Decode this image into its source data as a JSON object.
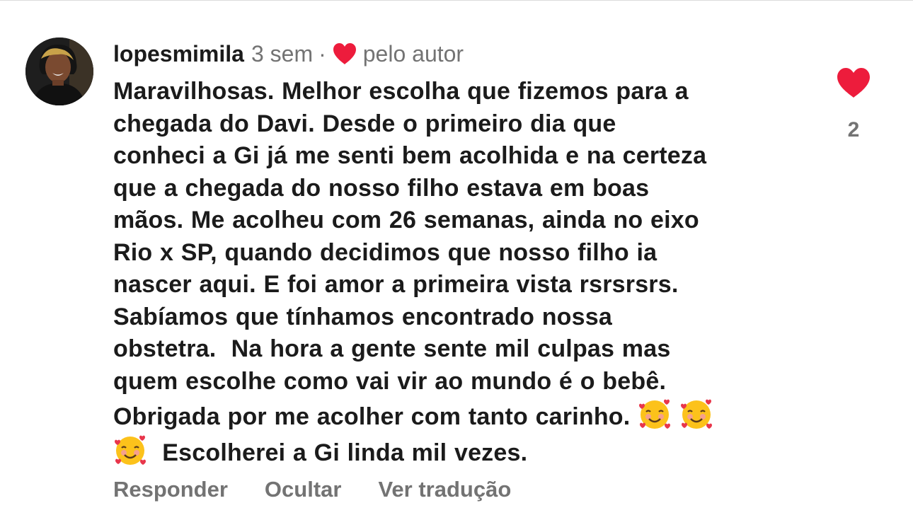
{
  "comment": {
    "username": "lopesmimila",
    "time": "3 sem",
    "separator": "·",
    "liked_by_author_label": "pelo autor",
    "body_lines": [
      "Maravilhosas. Melhor escolha que fizemos para a",
      "chegada do Davi. Desde o primeiro dia que",
      "conheci a Gi já me senti bem acolhida e na certeza",
      "que a chegada do nosso filho estava em boas",
      "mãos. Me acolheu com 26 semanas, ainda no eixo",
      "Rio x SP, quando decidimos que nosso filho ia",
      "nascer aqui. E foi amor a primeira vista rsrsrsrs.",
      "Sabíamos que tínhamos encontrado nossa",
      "obstetra.  Na hora a gente sente mil culpas mas",
      "quem escolhe como vai vir ao mundo é o bebê.",
      "Obrigada por me acolher com tanto carinho."
    ],
    "last_line": "Escolherei a Gi linda mil vezes.",
    "like_count": "2",
    "like_icon": "heart-filled-icon",
    "emoji_icon": "smiling-face-with-hearts-emoji"
  },
  "actions": {
    "reply": "Responder",
    "hide": "Ocultar",
    "translate": "Ver tradução"
  },
  "colors": {
    "heart": "#ed1c3c",
    "text": "#1b1b1b",
    "muted": "#737373"
  }
}
